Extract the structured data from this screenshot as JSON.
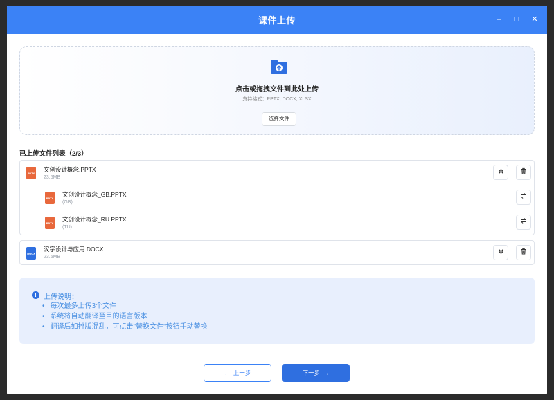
{
  "window": {
    "title": "课件上传",
    "controls": {
      "minimize": "–",
      "maximize": "□",
      "close": "✕"
    }
  },
  "dropzone": {
    "icon": "folder-upload-icon",
    "title": "点击或拖拽文件到此处上传",
    "formats": "支持格式：PPTX, DOCX, XLSX",
    "select_button": "选择文件"
  },
  "file_list": {
    "title": "已上传文件列表（2/3）",
    "groups": [
      {
        "name": "文创设计概念.PPTX",
        "size": "23.5MB",
        "type": "PPTX",
        "toggle_icon": "chevron-double-up-icon",
        "translations": [
          {
            "name": "文创设计概念_GB.PPTX",
            "lang": "(GB)",
            "type": "PPTX"
          },
          {
            "name": "文创设计概念_RU.PPTX",
            "lang": "(TU)",
            "type": "PPTX"
          }
        ]
      },
      {
        "name": "汉字设计与应用.DOCX",
        "size": "23.5MB",
        "type": "DOCX",
        "toggle_icon": "chevron-double-down-icon"
      }
    ]
  },
  "info": {
    "title": "上传说明：",
    "items": [
      "每次最多上传3个文件",
      "系统将自动翻译至目的语言版本",
      "翻译后如排版混乱，可点击\"替换文件\"按钮手动替换"
    ]
  },
  "nav": {
    "prev_label": "上一步",
    "next_label": "下一步"
  },
  "colors": {
    "primary": "#2f6fe0",
    "titlebar": "#3b82f6",
    "pptx": "#e8683c",
    "docx": "#2f6fe0",
    "info_bg": "#e8effd",
    "info_text": "#4a90e2"
  }
}
